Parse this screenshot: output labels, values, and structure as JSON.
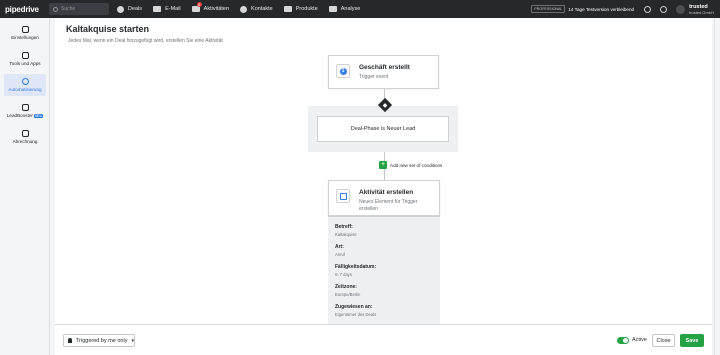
{
  "topbar": {
    "logo": "pipedrive",
    "search_placeholder": "Suche",
    "nav": [
      {
        "label": "Deals",
        "icon": "dollar-icon"
      },
      {
        "label": "E-Mail",
        "icon": "mail-icon"
      },
      {
        "label": "Aktivitäten",
        "icon": "calendar-icon",
        "badge": "8"
      },
      {
        "label": "Kontakte",
        "icon": "person-icon"
      },
      {
        "label": "Produkte",
        "icon": "box-icon"
      },
      {
        "label": "Analyse",
        "icon": "trend-icon"
      }
    ],
    "plan_tag": "PROFESSIONAL",
    "trial_text": "14 Tage Testversion verbleibend",
    "user_name": "trusted",
    "user_company": "trusted GmbH"
  },
  "sidebar": {
    "items": [
      {
        "label": "Einstellungen",
        "icon": "gear-icon"
      },
      {
        "label": "Tools und Apps",
        "icon": "tools-icon"
      },
      {
        "label": "Automatisierung",
        "icon": "robot-icon",
        "active": true
      },
      {
        "label": "LeadBooster",
        "icon": "chat-icon",
        "badge": "NEU"
      },
      {
        "label": "Abrechnung",
        "icon": "card-icon"
      }
    ]
  },
  "page": {
    "title": "Kaltakquise starten",
    "subtitle": "Jedes Mal, wenn ein Deal hinzugefügt wird, erstellen Sie eine Aktivität"
  },
  "trigger": {
    "title": "Geschäft erstellt",
    "sub": "Trigger event"
  },
  "condition": {
    "text": "Deal-Phase is Neuer Lead",
    "add_label": "Add new set of conditions"
  },
  "action": {
    "title": "Aktivität erstellen",
    "sub_line1": "Neues Element für Trigger",
    "sub_line2": "erstellen",
    "fields": [
      {
        "label": "Betreff:",
        "value": "Kaltakquise"
      },
      {
        "label": "Art:",
        "value": "Anruf"
      },
      {
        "label": "Fälligkeitsdatum:",
        "value": "In 7 days"
      },
      {
        "label": "Zeitzone:",
        "value": "Europe/Berlin"
      },
      {
        "label": "Zugewiesen an:",
        "value": "Eigentümer des Deals"
      }
    ]
  },
  "bottom": {
    "trigger_scope": "Triggered by me only",
    "active_label": "Active",
    "active": true,
    "close_label": "Close",
    "save_label": "Save"
  },
  "colors": {
    "topbar": "#26292c",
    "accent": "#317ae2",
    "success": "#25a244"
  }
}
